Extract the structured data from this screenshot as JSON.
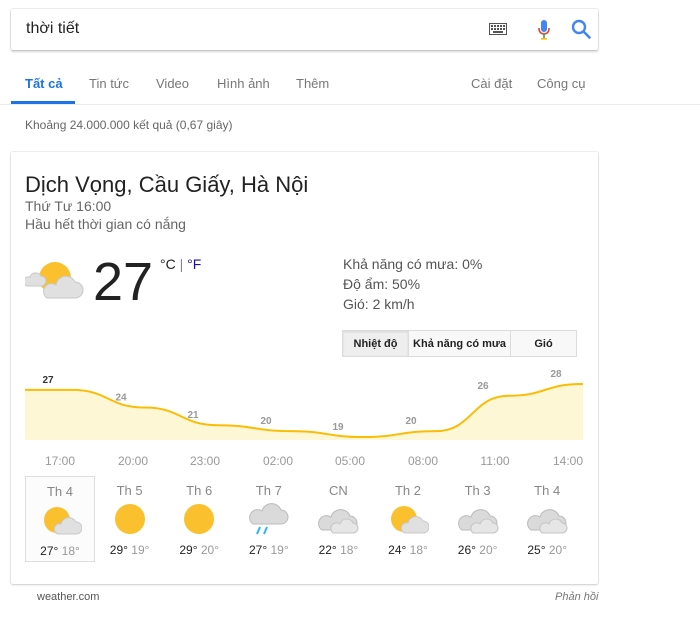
{
  "search": {
    "query": "thời tiết"
  },
  "nav": {
    "tabs": [
      {
        "label": "Tất cả",
        "active": true
      },
      {
        "label": "Tin tức"
      },
      {
        "label": "Video"
      },
      {
        "label": "Hình ảnh"
      },
      {
        "label": "Thêm"
      }
    ],
    "settings": "Cài đặt",
    "tools": "Công cụ"
  },
  "result_stats": "Khoảng 24.000.000 kết quả (0,67 giây)",
  "weather": {
    "location": "Dịch Vọng, Cầu Giấy, Hà Nội",
    "datetime": "Thứ Tư 16:00",
    "condition": "Hầu hết thời gian có nắng",
    "current_temp": "27",
    "unit_c": "°C",
    "unit_sep": "|",
    "unit_f": "°F",
    "details": {
      "rain": "Khả năng có mưa: 0%",
      "humidity": "Độ ẩm: 50%",
      "wind": "Gió: 2 km/h"
    },
    "toggles": [
      "Nhiệt độ",
      "Khả năng có mưa",
      "Gió"
    ],
    "chart_data": {
      "type": "area",
      "title": "",
      "xlabel": "",
      "ylabel": "",
      "x": [
        "17:00",
        "20:00",
        "23:00",
        "02:00",
        "05:00",
        "08:00",
        "11:00",
        "14:00"
      ],
      "values": [
        27,
        24,
        21,
        20,
        19,
        20,
        26,
        28
      ],
      "color": "#fbbc04",
      "fill": "#fef7d6"
    },
    "forecast": [
      {
        "day": "Th 4",
        "hi": "27°",
        "lo": "18°",
        "icon": "partly-sunny-icon"
      },
      {
        "day": "Th 5",
        "hi": "29°",
        "lo": "19°",
        "icon": "sunny-icon"
      },
      {
        "day": "Th 6",
        "hi": "29°",
        "lo": "20°",
        "icon": "sunny-icon"
      },
      {
        "day": "Th 7",
        "hi": "27°",
        "lo": "19°",
        "icon": "rain-icon"
      },
      {
        "day": "CN",
        "hi": "22°",
        "lo": "18°",
        "icon": "cloudy-icon"
      },
      {
        "day": "Th 2",
        "hi": "24°",
        "lo": "18°",
        "icon": "partly-sunny-icon"
      },
      {
        "day": "Th 3",
        "hi": "26°",
        "lo": "20°",
        "icon": "cloudy-icon"
      },
      {
        "day": "Th 4",
        "hi": "25°",
        "lo": "20°",
        "icon": "cloudy-icon"
      }
    ],
    "source": "weather.com",
    "feedback": "Phản hồi"
  }
}
